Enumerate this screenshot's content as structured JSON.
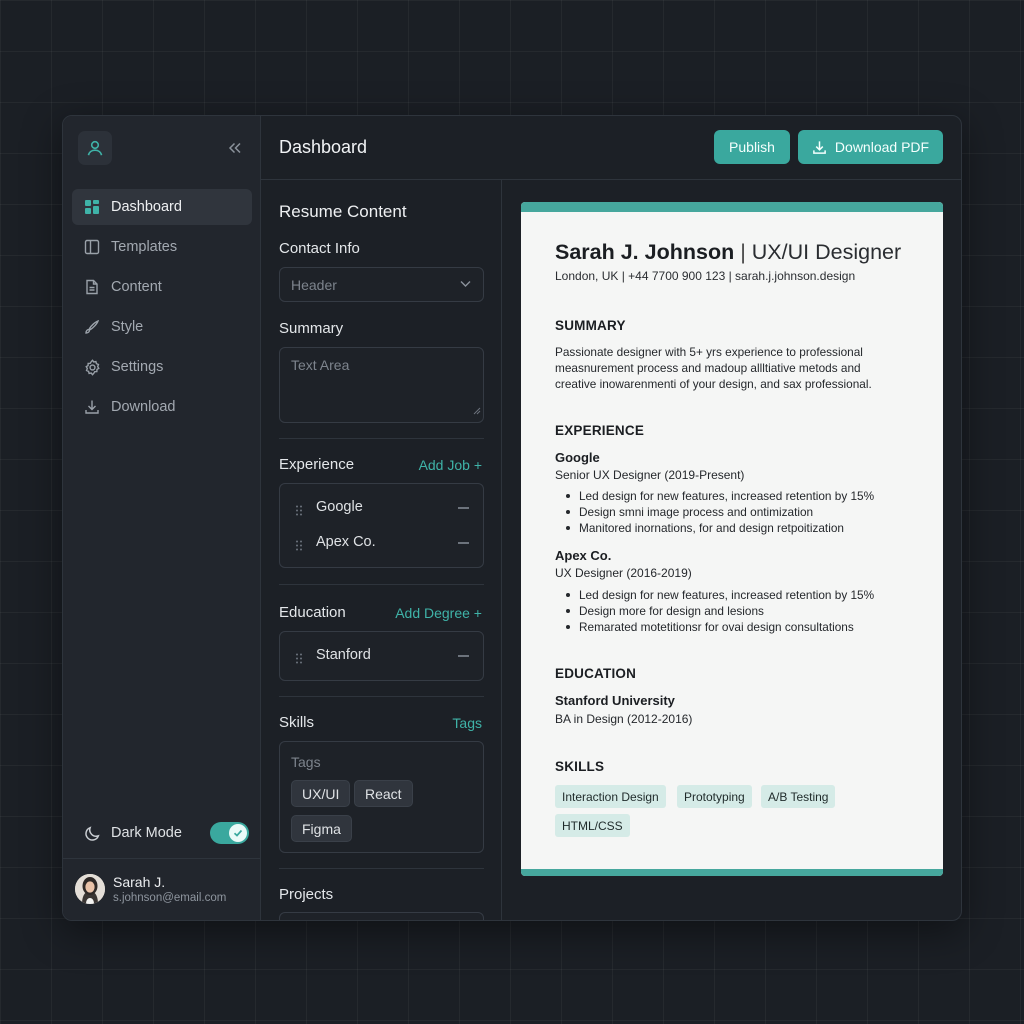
{
  "colors": {
    "accent": "#3aa89e",
    "background": "#1b1f25",
    "panel": "#22262d"
  },
  "sidebar": {
    "items": [
      {
        "label": "Dashboard",
        "icon": "grid-icon",
        "active": true
      },
      {
        "label": "Templates",
        "icon": "layout-icon"
      },
      {
        "label": "Content",
        "icon": "document-icon"
      },
      {
        "label": "Style",
        "icon": "brush-icon"
      },
      {
        "label": "Settings",
        "icon": "gear-icon"
      },
      {
        "label": "Download",
        "icon": "download-icon"
      }
    ],
    "dark_mode_label": "Dark Mode",
    "dark_mode_on": true,
    "user": {
      "name": "Sarah J.",
      "email": "s.johnson@email.com"
    }
  },
  "header": {
    "title": "Dashboard",
    "publish_label": "Publish",
    "download_label": "Download PDF"
  },
  "editor": {
    "title": "Resume Content",
    "contact": {
      "label": "Contact Info",
      "select_value": "Header"
    },
    "summary": {
      "label": "Summary",
      "placeholder": "Text Area"
    },
    "experience": {
      "label": "Experience",
      "action": "Add Job +",
      "items": [
        "Google",
        "Apex Co."
      ]
    },
    "education": {
      "label": "Education",
      "action": "Add Degree +",
      "items": [
        "Stanford"
      ]
    },
    "skills": {
      "label": "Skills",
      "action": "Tags",
      "placeholder": "Tags",
      "tags": [
        "UX/UI",
        "React",
        "Figma"
      ]
    },
    "projects": {
      "label": "Projects"
    }
  },
  "resume": {
    "name": "Sarah J. Johnson",
    "role": "UX/UI Designer",
    "contact": "London, UK | +44 7700 900 123 | sarah.j.johnson.design",
    "summary_heading": "SUMMARY",
    "summary_lines": [
      "Passionate designer with 5+ yrs experience to professional",
      "measnurement process and madoup allltiative metods and",
      "creative inowarenmenti of your design, and sax professional."
    ],
    "experience_heading": "EXPERIENCE",
    "jobs": [
      {
        "company": "Google",
        "title": "Senior UX Designer (2019-Present)",
        "bullets": [
          "Led design for new features, increased retention by 15%",
          "Design smni image process and ontimization",
          "Manitored inornations, for and design retpoitization"
        ]
      },
      {
        "company": "Apex Co.",
        "title": "UX Designer (2016-2019)",
        "bullets": [
          "Led design for new features, increased retention by 15%",
          "Design more for design and lesions",
          "Remarated motetitionsr for ovai design consultations"
        ]
      }
    ],
    "education_heading": "EDUCATION",
    "school": "Stanford University",
    "degree": "BA in Design (2012-2016)",
    "skills_heading": "SKILLS",
    "skills": [
      "Interaction Design",
      "Prototyping",
      "A/B Testing",
      "HTML/CSS"
    ]
  }
}
